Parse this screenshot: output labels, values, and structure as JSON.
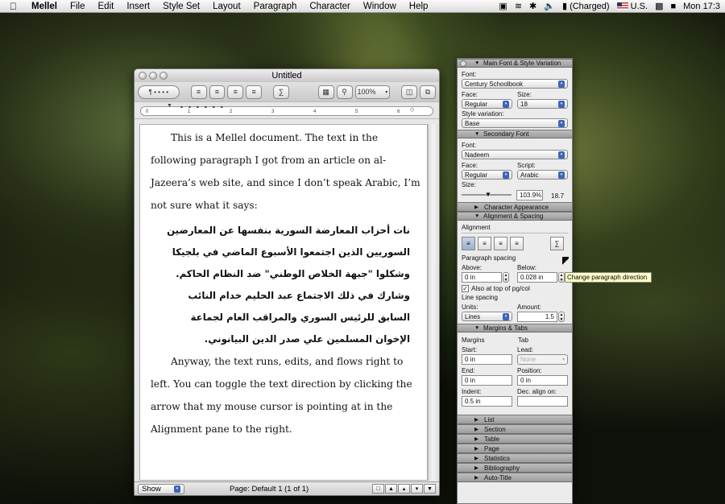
{
  "menubar": {
    "apple": "",
    "app": "Mellel",
    "items": [
      "File",
      "Edit",
      "Insert",
      "Style Set",
      "Layout",
      "Paragraph",
      "Character",
      "Window",
      "Help"
    ],
    "battery": "(Charged)",
    "input": "U.S.",
    "clock": "Mon 17:3"
  },
  "doc": {
    "title": "Untitled",
    "zoom": "100%",
    "ruler": [
      "0",
      "1",
      "2",
      "3",
      "4",
      "5",
      "6"
    ],
    "para1": "This is a Mellel document.  The text in the following paragraph I got from an article on al-Jazeera’s web site, and since I don’t speak Arabic, I’m not sure what it says:",
    "arabic": "نات أحزاب المعارضة السورية بنفسها عن المعارضين السوريين الذين اجتمعوا الأسبوع الماضي في بلجيكا وشكلوا \"جبهة الخلاص الوطني\" ضد النظام الحاكم. وشارك في ذلك الاجتماع عبد الحليم خدام النائب السابق للرئيس السوري والمراقب العام لجماعة الإخوان المسلمين علي صدر الدين البيانوني.",
    "para2": "Anyway, the text runs, edits, and flows right to left. You can toggle the text direction by clicking the arrow that my mouse cursor is pointing at in the Alignment pane to the right.",
    "show": "Show",
    "page": "Page: Default 1 (1 of 1)"
  },
  "insp": {
    "main_title": "Main Font & Style Variation",
    "font_label": "Font:",
    "font": "Century Schoolbook",
    "face_label": "Face:",
    "face": "Regular",
    "size_label": "Size:",
    "size": "18",
    "stylevar_label": "Style variation:",
    "stylevar": "Base",
    "sec_title": "Secondary Font",
    "sec_font_label": "Font:",
    "sec_font": "Nadeem",
    "sec_face_label": "Face:",
    "sec_face": "Regular",
    "script_label": "Script:",
    "script": "Arabic",
    "sec_size_label": "Size:",
    "sec_size_pct": "103.9%",
    "sec_size_val": "18.7",
    "char_app": "Character Appearance",
    "align_title": "Alignment & Spacing",
    "align_label": "Alignment",
    "para_spacing": "Paragraph spacing",
    "above_label": "Above:",
    "above": "0 in",
    "below_label": "Below:",
    "below": "0.028 in",
    "also_top": "Also at top of pg/col",
    "line_spacing": "Line spacing",
    "units_label": "Units:",
    "units": "Lines",
    "amount_label": "Amount:",
    "amount": "1.5",
    "margins_title": "Margins & Tabs",
    "margins_label": "Margins",
    "tab_label": "Tab",
    "start_label": "Start:",
    "start": "0 in",
    "lead_label": "Lead:",
    "lead": "None",
    "end_label": "End:",
    "end": "0 in",
    "position_label": "Position:",
    "position": "0 in",
    "indent_label": "Indent:",
    "indent": "0.5 in",
    "dec_label": "Dec. align on:",
    "dec": "",
    "collapsed": [
      "List",
      "Section",
      "Table",
      "Page",
      "Statistics",
      "Bibliography",
      "Auto-Title"
    ],
    "tooltip": "Change paragraph direction"
  }
}
